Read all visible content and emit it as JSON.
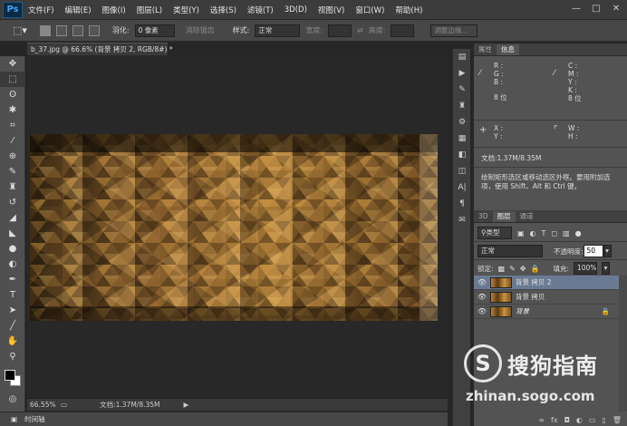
{
  "app": {
    "logo": "Ps"
  },
  "menu": [
    "文件(F)",
    "编辑(E)",
    "图像(I)",
    "图层(L)",
    "类型(Y)",
    "选择(S)",
    "滤镜(T)",
    "3D(D)",
    "视图(V)",
    "窗口(W)",
    "帮助(H)"
  ],
  "window_controls": [
    "—",
    "□",
    "✕"
  ],
  "options": {
    "feather_label": "羽化:",
    "feather_value": "0 像素",
    "antialias": "消除锯齿",
    "style_label": "样式:",
    "style_value": "正常",
    "width_label": "宽度:",
    "height_label": "高度:",
    "refine_edge": "调整边缘..."
  },
  "document": {
    "tab_title": "b_37.jpg @ 66.6% (背景 拷贝 2, RGB/8#) *",
    "zoom": "66.55%",
    "doc_size": "文档:1.37M/8.35M"
  },
  "timeline": {
    "label": "时间轴"
  },
  "info_panel": {
    "tabs": [
      "属性",
      "信息"
    ],
    "r": "R :",
    "g": "G :",
    "b": "B :",
    "c": "C :",
    "m": "M :",
    "y": "Y :",
    "k": "K :",
    "bits_left": "8 位",
    "bits_right": "8 位",
    "x": "X :",
    "y2": "Y :",
    "w": "W :",
    "h": "H :",
    "doc": "文档:1.37M/8.35M",
    "hint": "绘制矩形选区或移动选区外框。要用附加选项，使用 Shift、Alt 和 Ctrl 键。"
  },
  "layers_panel": {
    "tabs": [
      "3D",
      "图层",
      "通道"
    ],
    "filter_kind": "类型",
    "blend_mode": "正常",
    "opacity_label": "不透明度:",
    "opacity_value": "50",
    "lock_label": "锁定:",
    "fill_label": "填充:",
    "fill_value": "100%",
    "layers": [
      {
        "name": "背景 拷贝 2",
        "selected": true
      },
      {
        "name": "背景 拷贝",
        "selected": false
      },
      {
        "name": "背景",
        "selected": false
      }
    ],
    "bottom_icons": [
      "∞",
      "fx",
      "◘",
      "◐",
      "▭",
      "▯",
      "🗑"
    ]
  },
  "watermark": {
    "logo_letter": "S",
    "name": "搜狗指南",
    "url": "zhinan.sogo.com"
  }
}
